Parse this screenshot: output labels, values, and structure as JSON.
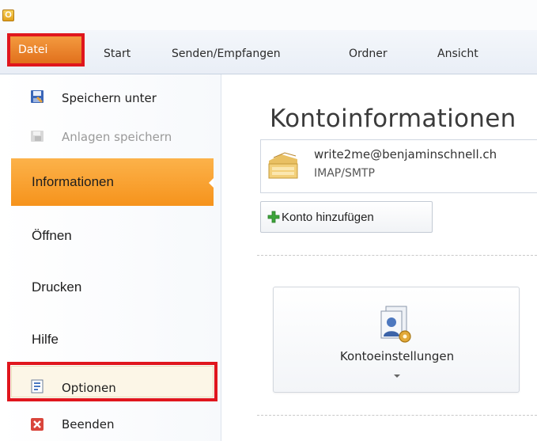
{
  "app": {
    "icon_letter": "O",
    "icon_name": "outlook-icon"
  },
  "ribbon": {
    "tabs": [
      {
        "label": "Datei",
        "selected": true
      },
      {
        "label": "Start"
      },
      {
        "label": "Senden/Empfangen"
      },
      {
        "label": "Ordner"
      },
      {
        "label": "Ansicht"
      }
    ]
  },
  "backstage": {
    "commands": [
      {
        "label": "Speichern unter",
        "icon": "save-as-icon",
        "enabled": true
      },
      {
        "label": "Anlagen speichern",
        "icon": "save-attachments-icon",
        "enabled": false
      }
    ],
    "nav": [
      {
        "label": "Informationen",
        "selected": true
      },
      {
        "label": "Öffnen"
      },
      {
        "label": "Drucken"
      },
      {
        "label": "Hilfe"
      }
    ],
    "options": {
      "label": "Optionen",
      "icon": "options-icon"
    },
    "exit": {
      "label": "Beenden",
      "icon": "exit-icon"
    }
  },
  "main": {
    "title": "Kontoinformationen",
    "account": {
      "email": "write2me@benjaminschnell.ch",
      "type": "IMAP/SMTP",
      "icon": "mail-account-icon"
    },
    "add_account_label": "Konto hinzufügen",
    "settings_button": {
      "label": "Kontoeinstellungen",
      "icon": "account-settings-icon"
    }
  },
  "colors": {
    "accent_orange": "#f6931c",
    "file_tab": "#e1701c",
    "highlight_red": "#e0161d"
  }
}
